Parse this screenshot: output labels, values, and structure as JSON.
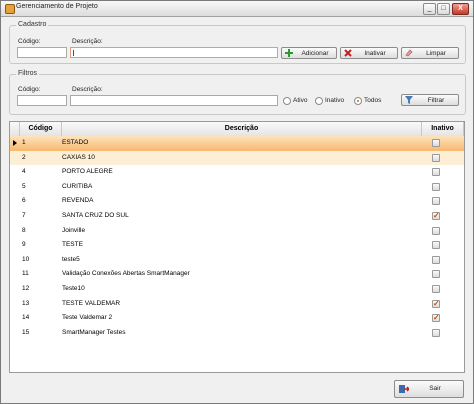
{
  "window": {
    "title": "Gerenciamento de Projeto",
    "min_label": "_",
    "max_label": "□",
    "close_label": "X"
  },
  "cadastro": {
    "legend": "Cadastro",
    "codigo_label": "Código:",
    "descricao_label": "Descrição:",
    "codigo_value": "",
    "descricao_value": "",
    "adicionar_label": "Adicionar",
    "inativar_label": "Inativar",
    "limpar_label": "Limpar"
  },
  "filtros": {
    "legend": "Filtros",
    "codigo_label": "Código:",
    "descricao_label": "Descrição:",
    "codigo_value": "",
    "descricao_value": "",
    "ativo_label": "Ativo",
    "inativo_label": "Inativo",
    "todos_label": "Todos",
    "selected": "Todos",
    "filtrar_label": "Filtrar"
  },
  "grid": {
    "columns": [
      "Código",
      "Descrição",
      "Inativo"
    ],
    "rows": [
      {
        "codigo": "1",
        "descricao": "ESTADO",
        "inativo": false
      },
      {
        "codigo": "2",
        "descricao": "CAXIAS 10",
        "inativo": false
      },
      {
        "codigo": "4",
        "descricao": "PORTO ALEGRE",
        "inativo": false
      },
      {
        "codigo": "5",
        "descricao": "CURITIBA",
        "inativo": false
      },
      {
        "codigo": "6",
        "descricao": "REVENDA",
        "inativo": false
      },
      {
        "codigo": "7",
        "descricao": "SANTA CRUZ DO SUL",
        "inativo": true
      },
      {
        "codigo": "8",
        "descricao": "Joinville",
        "inativo": false
      },
      {
        "codigo": "9",
        "descricao": "TESTE",
        "inativo": false
      },
      {
        "codigo": "10",
        "descricao": "teste5",
        "inativo": false
      },
      {
        "codigo": "11",
        "descricao": "Validação Conexões Abertas SmartManager",
        "inativo": false
      },
      {
        "codigo": "12",
        "descricao": "Teste10",
        "inativo": false
      },
      {
        "codigo": "13",
        "descricao": "TESTE  VALDEMAR",
        "inativo": true
      },
      {
        "codigo": "14",
        "descricao": "Teste Valdemar 2",
        "inativo": true
      },
      {
        "codigo": "15",
        "descricao": "SmartManager Testes",
        "inativo": false
      }
    ]
  },
  "footer": {
    "sair_label": "Sair"
  }
}
